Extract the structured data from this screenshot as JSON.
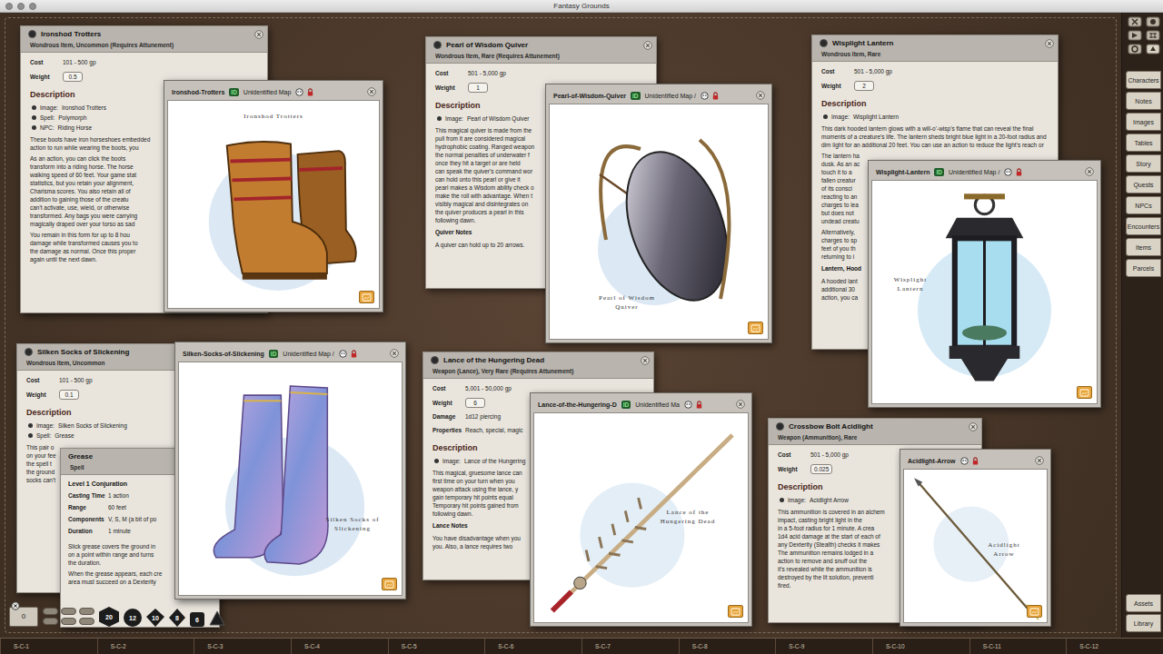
{
  "window": {
    "title": "Fantasy Grounds"
  },
  "windows": [
    {
      "kind": "record",
      "title": "Ironshod Trotters",
      "subtitle": "Wondrous Item, Uncommon (Requires Attunement)",
      "fields": [
        {
          "label": "Cost",
          "value": "101 - 500 gp",
          "kind": "text"
        },
        {
          "label": "Weight",
          "value": "0.5",
          "kind": "box"
        }
      ],
      "sections": [
        {
          "heading": "Description",
          "kind": "main",
          "bullets": [
            {
              "label": "Image:",
              "value": "Ironshod Trotters"
            },
            {
              "label": "Spell:",
              "value": "Polymorph"
            },
            {
              "label": "NPC:",
              "value": "Riding Horse"
            }
          ],
          "paragraphs": [
            {
              "kind": "lines",
              "lines": [
                "These boots have iron horseshoes embedded",
                "action to run while wearing the boots, you"
              ]
            },
            {
              "kind": "lines",
              "lines": [
                "As an action, you can click the boots",
                "transform into a riding horse. The horse",
                "walking speed of 60 feet. Your game stat",
                "statistics, but you retain your alignment,",
                "Charisma scores. You also retain all of",
                "addition to gaining those of the creatu",
                "can't activate, use, wield, or otherwise",
                "transformed. Any bags you were carrying",
                "magically draped over your torso as sad"
              ]
            },
            {
              "kind": "lines",
              "lines": [
                "You remain in this form for up to 8 hou",
                "damage while transformed causes you to",
                "the damage as normal. Once this proper",
                "again until the next dawn."
              ]
            }
          ]
        }
      ]
    },
    {
      "kind": "image",
      "title": "Ironshod-Trotters",
      "badge": "ID",
      "map_label": "Unidentified Map",
      "caption": "Ironshod Trotters"
    },
    {
      "kind": "record",
      "title": "Pearl of Wisdom Quiver",
      "subtitle": "Wondrous Item, Rare (Requires Attunement)",
      "fields": [
        {
          "label": "Cost",
          "value": "501 - 5,000 gp",
          "kind": "text"
        },
        {
          "label": "Weight",
          "value": "1",
          "kind": "box"
        }
      ],
      "sections": [
        {
          "heading": "Description",
          "kind": "main",
          "bullets": [
            {
              "label": "Image:",
              "value": "Pearl of Wisdom Quiver"
            }
          ],
          "paragraphs": [
            {
              "kind": "lines",
              "lines": [
                "This magical quiver is made from the",
                "pull from it are considered magical",
                "hydrophobic coating. Ranged weapon",
                "the normal penalties of underwater f",
                "once they hit a target or are held",
                "can speak the quiver's command wor",
                "can hold onto this pearl or give it",
                "pearl makes a Wisdom ability check o",
                "make the roll with advantage. When t",
                "visibly magical and disintegrates on",
                "the quiver produces a pearl in this",
                "following dawn."
              ]
            }
          ]
        },
        {
          "heading": "Quiver Notes",
          "kind": "sub",
          "bullets": [],
          "paragraphs": [
            {
              "kind": "lines",
              "lines": [
                "A quiver can hold up to 20 arrows."
              ]
            }
          ]
        }
      ]
    },
    {
      "kind": "image",
      "title": "Pearl-of-Wisdom-Quiver",
      "badge": "ID",
      "map_label": "Unidentified Map /",
      "caption": "Pearl of Wisdom Quiver"
    },
    {
      "kind": "record",
      "title": "Wisplight Lantern",
      "subtitle": "Wondrous Item, Rare",
      "fields": [
        {
          "label": "Cost",
          "value": "501 - 5,000 gp",
          "kind": "text"
        },
        {
          "label": "Weight",
          "value": "2",
          "kind": "box"
        }
      ],
      "sections": [
        {
          "heading": "Description",
          "kind": "main",
          "bullets": [
            {
              "label": "Image:",
              "value": "Wisplight Lantern"
            }
          ],
          "paragraphs": [
            {
              "kind": "wrap",
              "text": "This dark hooded lantern glows with a will-o'-wisp's flame that can reveal the final moments of a creature's life. The lantern sheds bright blue light in a 20-foot radius and dim light for an additional 20 feet. You can use an action to reduce the light's reach or"
            },
            {
              "kind": "lines",
              "lines": [
                "The lantern ha",
                "dusk. As an ac",
                "touch it to a",
                "fallen creatur",
                "of its consci",
                "reacting to an",
                "charges to lea",
                "but does not",
                "undead creatu"
              ]
            },
            {
              "kind": "lines",
              "lines": [
                "Alternatively,",
                "charges to sp",
                "feet of you th",
                "returning to i"
              ]
            }
          ]
        },
        {
          "heading": "Lantern, Hood",
          "kind": "sub",
          "bullets": [],
          "paragraphs": [
            {
              "kind": "lines",
              "lines": [
                "A hooded lant",
                "additional 30",
                "action, you ca"
              ]
            }
          ]
        }
      ]
    },
    {
      "kind": "image",
      "title": "Wisplight-Lantern",
      "badge": "ID",
      "map_label": "Unidentified Map /",
      "caption": "Wisplight Lantern"
    },
    {
      "kind": "record",
      "title": "Silken Socks of Slickening",
      "subtitle": "Wondrous Item, Uncommon",
      "fields": [
        {
          "label": "Cost",
          "value": "101 - 500 gp",
          "kind": "text"
        },
        {
          "label": "Weight",
          "value": "0.1",
          "kind": "box"
        }
      ],
      "sections": [
        {
          "heading": "Description",
          "kind": "main",
          "bullets": [
            {
              "label": "Image:",
              "value": "Silken Socks of Slickening"
            },
            {
              "label": "Spell:",
              "value": "Grease"
            }
          ],
          "paragraphs": [
            {
              "kind": "lines",
              "lines": [
                "This pair o",
                "on your fee",
                "the spell t",
                "the ground",
                "socks can't"
              ]
            }
          ]
        }
      ]
    },
    {
      "kind": "spell",
      "title": "Grease",
      "subtitle": "Spell",
      "level": "Level 1 Conjuration",
      "fields": [
        {
          "label": "Casting Time",
          "value": "1 action"
        },
        {
          "label": "Range",
          "value": "60 feet"
        },
        {
          "label": "Components",
          "value": "V, S, M (a bit of po"
        },
        {
          "label": "Duration",
          "value": "1 minute"
        }
      ],
      "paragraphs": [
        {
          "kind": "lines",
          "lines": [
            "Slick grease covers the ground in",
            "on a point within range and turns",
            "the duration."
          ]
        },
        {
          "kind": "lines",
          "lines": [
            "When the grease appears, each cre",
            "area must succeed on a Dexterity"
          ]
        }
      ]
    },
    {
      "kind": "image",
      "title": "Silken-Socks-of-Slickening",
      "badge": "ID",
      "map_label": "Unidentified Map /",
      "caption": "Silken Socks of Slickening"
    },
    {
      "kind": "record",
      "title": "Lance of the Hungering Dead",
      "subtitle": "Weapon (Lance), Very Rare (Requires Attunement)",
      "fields": [
        {
          "label": "Cost",
          "value": "5,001 - 50,000 gp",
          "kind": "text"
        },
        {
          "label": "Weight",
          "value": "6",
          "kind": "box"
        },
        {
          "label": "Damage",
          "value": "1d12 piercing",
          "kind": "text"
        },
        {
          "label": "Properties",
          "value": "Reach, special, magic",
          "kind": "text"
        }
      ],
      "sections": [
        {
          "heading": "Description",
          "kind": "main",
          "bullets": [
            {
              "label": "Image:",
              "value": "Lance of the Hungering"
            }
          ],
          "paragraphs": [
            {
              "kind": "lines",
              "lines": [
                "This magical, gruesome lance can",
                "first time on your turn when you",
                "weapon attack using the lance, y",
                "gain temporary hit points equal",
                "Temporary hit points gained from",
                "following dawn."
              ]
            }
          ]
        },
        {
          "heading": "Lance Notes",
          "kind": "sub",
          "bullets": [],
          "paragraphs": [
            {
              "kind": "lines",
              "lines": [
                "You have disadvantage when you",
                "you. Also, a lance requires two"
              ]
            }
          ]
        }
      ]
    },
    {
      "kind": "image",
      "title": "Lance-of-the-Hungering-D",
      "badge": "ID",
      "map_label": "Unidentified Ma",
      "caption": "Lance of the Hungering Dead"
    },
    {
      "kind": "record",
      "title": "Crossbow Bolt Acidlight",
      "subtitle": "Weapon (Ammunition), Rare",
      "fields": [
        {
          "label": "Cost",
          "value": "501 - 5,000 gp",
          "kind": "text"
        },
        {
          "label": "Weight",
          "value": "0.025",
          "kind": "box"
        }
      ],
      "sections": [
        {
          "heading": "Description",
          "kind": "main",
          "bullets": [
            {
              "label": "Image:",
              "value": "Acidlight Arrow"
            }
          ],
          "paragraphs": [
            {
              "kind": "lines",
              "lines": [
                "This ammunition is covered in an alchem",
                "impact, casting bright light in the",
                "in a 5-foot radius for 1 minute. A crea",
                "1d4 acid damage at the start of each of",
                "any Dexterity (Stealth) checks it makes",
                "The ammunition remains lodged in a",
                "action to remove and snuff out the",
                "it's revealed while the ammunition is",
                "destroyed by the lit solution, preventi",
                "fired."
              ]
            }
          ]
        }
      ]
    },
    {
      "kind": "image",
      "title": "Acidlight-Arrow",
      "caption": "Acidlight Arrow"
    }
  ],
  "sidebar": {
    "items": [
      "Characters",
      "Notes",
      "Images",
      "Tables",
      "Story",
      "Quests",
      "NPCs",
      "Encounters",
      "Items",
      "Parcels"
    ],
    "bottom_items": [
      "Assets",
      "Library"
    ]
  },
  "dice_tray": {
    "modifier": "0",
    "dice": [
      "20",
      "12",
      "10",
      "8",
      "6"
    ]
  },
  "hotbar": {
    "slots": [
      "S-C-1",
      "S-C-2",
      "S-C-3",
      "S-C-4",
      "S-C-5",
      "S-C-6",
      "S-C-7",
      "S-C-8",
      "S-C-9",
      "S-C-10",
      "S-C-11",
      "S-C-12"
    ]
  }
}
